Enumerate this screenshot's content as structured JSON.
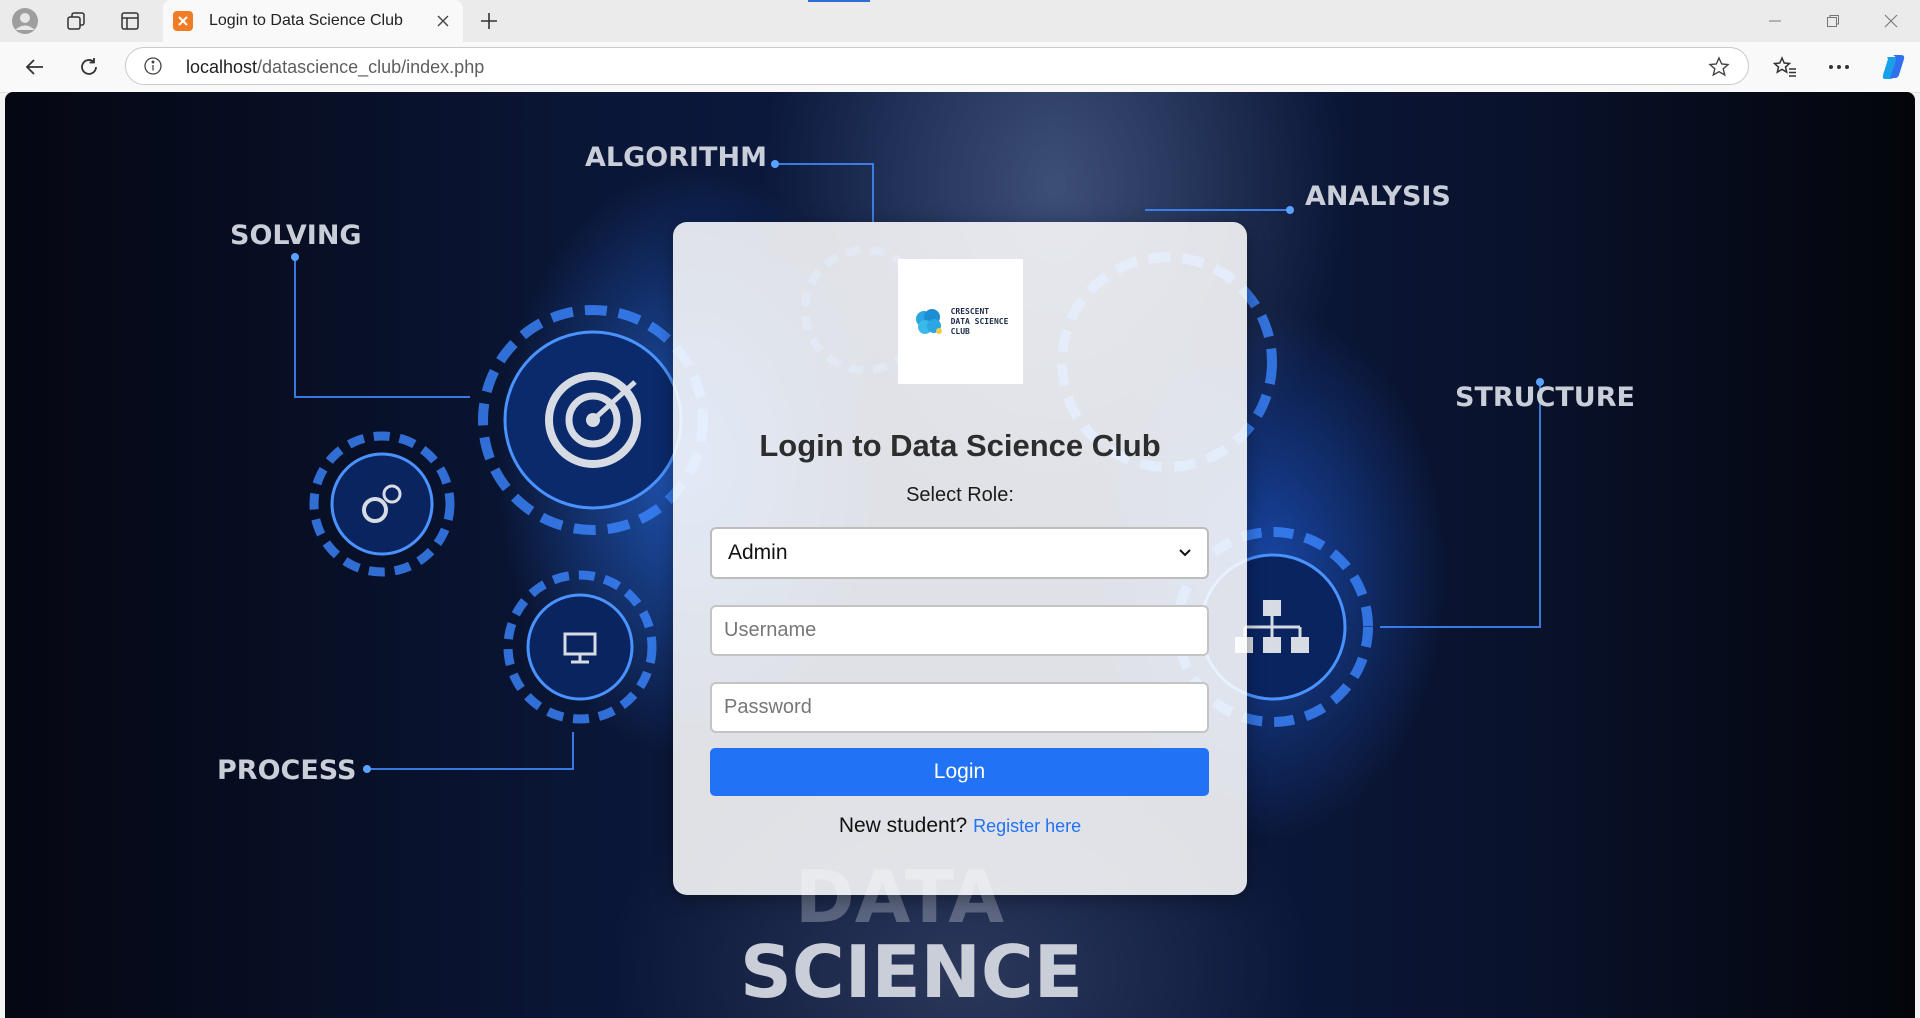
{
  "browser": {
    "tab_title": "Login to Data Science Club",
    "url_host": "localhost",
    "url_path": "/datascience_club/index.php"
  },
  "background": {
    "labels": {
      "solving": "SOLVING",
      "algorithm": "ALGORITHM",
      "analysis": "ANALYSIS",
      "structure": "STRUCTURE",
      "process": "PROCESS",
      "data": "DATA",
      "science": "SCIENCE"
    }
  },
  "logo": {
    "line1": "CRESCENT",
    "line2": "DATA SCIENCE",
    "line3": "CLUB"
  },
  "login": {
    "title": "Login to Data Science Club",
    "role_label": "Select Role:",
    "role_value": "Admin",
    "username_placeholder": "Username",
    "password_placeholder": "Password",
    "submit_label": "Login",
    "register_prompt": "New student?",
    "register_link": "Register here"
  },
  "colors": {
    "accent": "#2172f5",
    "card_background": "#ffffff",
    "page_background": "#0b1a40"
  }
}
